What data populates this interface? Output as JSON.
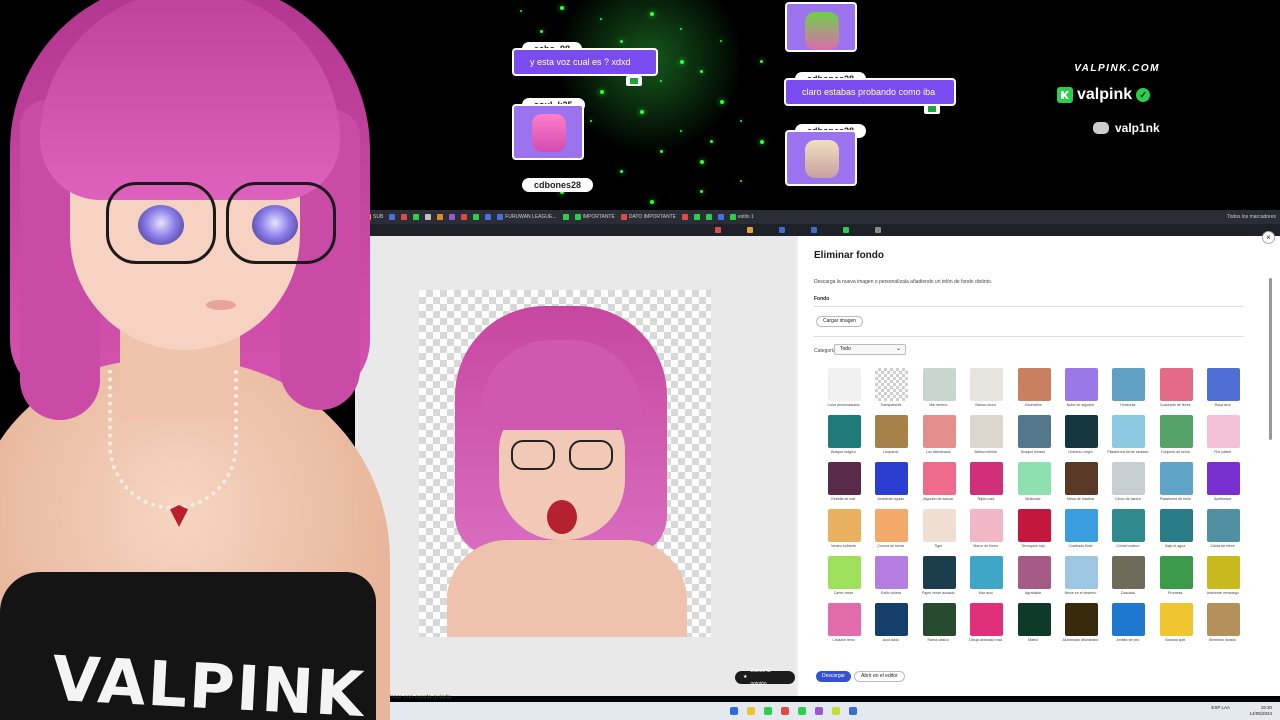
{
  "overlay": {
    "chats": [
      {
        "user": "echo_98",
        "message": "y esta voz cual es ? xdxd"
      },
      {
        "user": "soul_k25",
        "message": ""
      },
      {
        "user": "cdbones28",
        "message": ""
      },
      {
        "user": "cdbones28",
        "message": "claro estabas probando como iba"
      },
      {
        "user": "cdbones28",
        "message": ""
      }
    ],
    "brand": {
      "url": "VALPINK.COM",
      "kick_name": "valpink",
      "discord_name": "valp1nk"
    },
    "colors": {
      "bubble": "#7a4cf0",
      "sparkle": "#2dff3a",
      "kick": "#2bd04a"
    }
  },
  "bookmarks": [
    {
      "label": "SUB",
      "color": "#f0a030"
    },
    {
      "label": "FURUWAN LEAGUE...",
      "color": "#4b6ee0"
    },
    {
      "label": "IMPORTANTE",
      "color": "#2bd04a"
    },
    {
      "label": "DATO IMPORTANTE",
      "color": "#e24a4a"
    },
    {
      "label": "estilo 1",
      "color": "#2bd04a"
    }
  ],
  "bookmarks_right": "Todos los marcadores",
  "panel": {
    "title": "Eliminar fondo",
    "description": "Descarga la nueva imagen o personalízala añadiendo un telón de fondo distinto.",
    "section": "Fondo",
    "upload_label": "Cargar imagen",
    "category_label": "Categoría",
    "category_value": "Todo",
    "download_label": "Descargar",
    "editor_label": "Abrir en el editor",
    "backgrounds": [
      {
        "label": "Color personalizado",
        "color": "#f1f1f1"
      },
      {
        "label": "Transparente",
        "color": "#dcdcdc"
      },
      {
        "label": "Mar sereno",
        "color": "#c7d7d0"
      },
      {
        "label": "Blanco niveo",
        "color": "#e7e3dd"
      },
      {
        "label": "Geometria",
        "color": "#c9805f"
      },
      {
        "label": "Nube de algodón",
        "color": "#9a79e6"
      },
      {
        "label": "Horizonte",
        "color": "#5f9fc4"
      },
      {
        "label": "Cuadrado de flores",
        "color": "#e46a8a"
      },
      {
        "label": "Rosa azul",
        "color": "#4f6fd7"
      },
      {
        "label": "Bosque mágico",
        "color": "#1e7b78"
      },
      {
        "label": "Leopardo",
        "color": "#a7814a"
      },
      {
        "label": "Luz difuminada",
        "color": "#e58e8e"
      },
      {
        "label": "Blanco infinito",
        "color": "#dcd6cf"
      },
      {
        "label": "Bosque helado",
        "color": "#53788c"
      },
      {
        "label": "Universo negro",
        "color": "#15363f"
      },
      {
        "label": "Plataforma verde azulado",
        "color": "#8cc8e0"
      },
      {
        "label": "Conjunto de selva",
        "color": "#56a36a"
      },
      {
        "label": "Flor pastel",
        "color": "#f2c1d8"
      },
      {
        "label": "Estrella de mar",
        "color": "#5a2a4a"
      },
      {
        "label": "Ambiente líquido",
        "color": "#2c3ed1"
      },
      {
        "label": "Algodón de azúcar",
        "color": "#f06a8c"
      },
      {
        "label": "Tejido rosa",
        "color": "#d0307a"
      },
      {
        "label": "Multicolor",
        "color": "#8fe0b0"
      },
      {
        "label": "Mesa de madera",
        "color": "#5a3a26"
      },
      {
        "label": "Cerco de piedra",
        "color": "#c7ced2"
      },
      {
        "label": "Plataforma de hielo",
        "color": "#5fa3c8"
      },
      {
        "label": "Synthwave",
        "color": "#7a2fd0"
      },
      {
        "label": "Verano brillante",
        "color": "#e9b05f"
      },
      {
        "label": "Corona de borde",
        "color": "#f2a96a"
      },
      {
        "label": "Tigre",
        "color": "#eedfd2"
      },
      {
        "label": "Marco de flores",
        "color": "#f0b7c7"
      },
      {
        "label": "Terciopelo rojo",
        "color": "#c4173e"
      },
      {
        "label": "Cuadrado Bold",
        "color": "#3a9de0"
      },
      {
        "label": "Cristal costero",
        "color": "#2f8a8e"
      },
      {
        "label": "Bajo el agua",
        "color": "#2a7c86"
      },
      {
        "label": "Caída de nieve",
        "color": "#4f8fa0"
      },
      {
        "label": "Cartel verde",
        "color": "#9ee05a"
      },
      {
        "label": "Estilo violeta",
        "color": "#b37ee0"
      },
      {
        "label": "Papel verde azulado",
        "color": "#1c3d4b"
      },
      {
        "label": "Mar azul",
        "color": "#3fa6c8"
      },
      {
        "label": "Agradable",
        "color": "#a65a86"
      },
      {
        "label": "Nieve en el desierto",
        "color": "#9dc6e2"
      },
      {
        "label": "Cascada",
        "color": "#6e6b5a"
      },
      {
        "label": "Promesa",
        "color": "#3c9a4a"
      },
      {
        "label": "Ambiente veraniego",
        "color": "#c9b81e"
      },
      {
        "label": "Corazón lleno",
        "color": "#e16bab"
      },
      {
        "label": "Azul ácido",
        "color": "#133f6a"
      },
      {
        "label": "Rama clásico",
        "color": "#284a2f"
      },
      {
        "label": "Dibujo animado rosa",
        "color": "#e0307a"
      },
      {
        "label": "Matriz",
        "color": "#0e3a2a"
      },
      {
        "label": "Alumbrado difuminado",
        "color": "#3a2a0c"
      },
      {
        "label": "Ámbito de pez",
        "color": "#1e78d0"
      },
      {
        "label": "Banana split",
        "color": "#efc62f"
      },
      {
        "label": "Elemento dorado",
        "color": "#b4915a"
      }
    ]
  },
  "canvas": {
    "feedback_label": "Danos tu opinión",
    "guided_label": "Crear con ayuda guiada"
  },
  "taskbar": {
    "time": "19:30",
    "date": "14/05/2024",
    "lang": "ESP LAA"
  },
  "model": {
    "shirt_text": "VALPINK",
    "hair_color": "#c94ba6"
  }
}
